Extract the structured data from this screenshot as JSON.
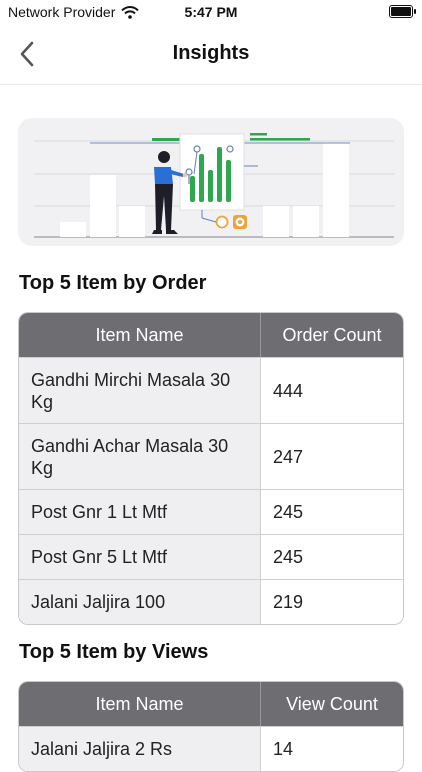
{
  "status_bar": {
    "carrier": "Network Provider",
    "time": "5:47 PM"
  },
  "header": {
    "title": "Insights"
  },
  "orders": {
    "title": "Top 5 Item by Order",
    "columns": [
      "Item Name",
      "Order Count"
    ],
    "rows": [
      {
        "name": "Gandhi Mirchi Masala 30 Kg",
        "count": "444"
      },
      {
        "name": "Gandhi Achar Masala 30 Kg",
        "count": "247"
      },
      {
        "name": "Post Gnr 1 Lt Mtf",
        "count": "245"
      },
      {
        "name": "Post Gnr 5 Lt Mtf",
        "count": "245"
      },
      {
        "name": "Jalani Jaljira 100",
        "count": "219"
      }
    ]
  },
  "views": {
    "title": "Top 5 Item by Views",
    "columns": [
      "Item Name",
      "View Count"
    ],
    "rows": [
      {
        "name": "Jalani Jaljira 2 Rs",
        "count": "14"
      }
    ]
  },
  "colors": {
    "accent_green": "#2ea84f",
    "header_gray": "#6e6e72",
    "shirt_blue": "#2a6fd6",
    "orange": "#f0a23a"
  }
}
